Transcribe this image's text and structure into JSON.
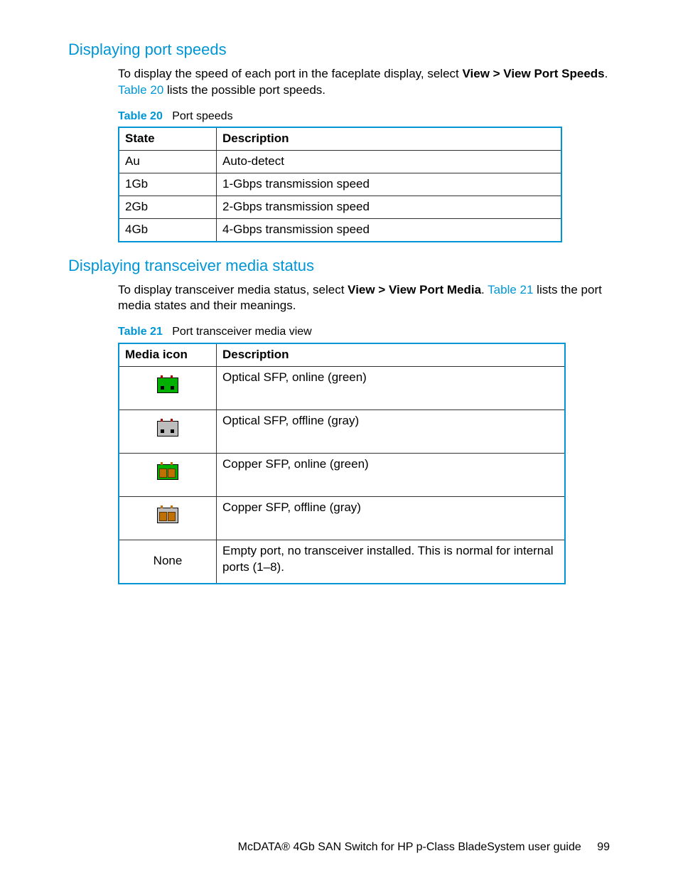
{
  "section1": {
    "heading": "Displaying port speeds",
    "para_pre": "To display the speed of each port in the faceplate display, select ",
    "menu_path": "View > View Port Speeds",
    "para_mid": ". ",
    "table_ref": "Table 20",
    "para_post": " lists the possible port speeds.",
    "table_caption_label": "Table 20",
    "table_caption_name": "Port speeds",
    "headers": {
      "c1": "State",
      "c2": "Description"
    },
    "rows": [
      {
        "c1": "Au",
        "c2": "Auto-detect"
      },
      {
        "c1": "1Gb",
        "c2": "1-Gbps transmission speed"
      },
      {
        "c1": "2Gb",
        "c2": "2-Gbps transmission speed"
      },
      {
        "c1": "4Gb",
        "c2": "4-Gbps transmission speed"
      }
    ]
  },
  "section2": {
    "heading": "Displaying transceiver media status",
    "para_pre": "To display transceiver media status, select ",
    "menu_path": "View > View Port Media",
    "para_mid": ". ",
    "table_ref": "Table 21",
    "para_post": " lists the port media states and their meanings.",
    "table_caption_label": "Table 21",
    "table_caption_name": "Port transceiver media view",
    "headers": {
      "c1": "Media icon",
      "c2": "Description"
    },
    "rows": [
      {
        "icon": "optical-online",
        "c2": "Optical SFP, online (green)"
      },
      {
        "icon": "optical-offline",
        "c2": "Optical SFP, offline (gray)"
      },
      {
        "icon": "copper-online",
        "c2": "Copper SFP, online (green)"
      },
      {
        "icon": "copper-offline",
        "c2": "Copper SFP, offline (gray)"
      },
      {
        "icon_text": "None",
        "c2": "Empty port, no transceiver installed. This is normal for internal ports (1–8)."
      }
    ]
  },
  "footer": {
    "title": "McDATA® 4Gb SAN Switch for HP p-Class BladeSystem user guide",
    "page": "99"
  }
}
